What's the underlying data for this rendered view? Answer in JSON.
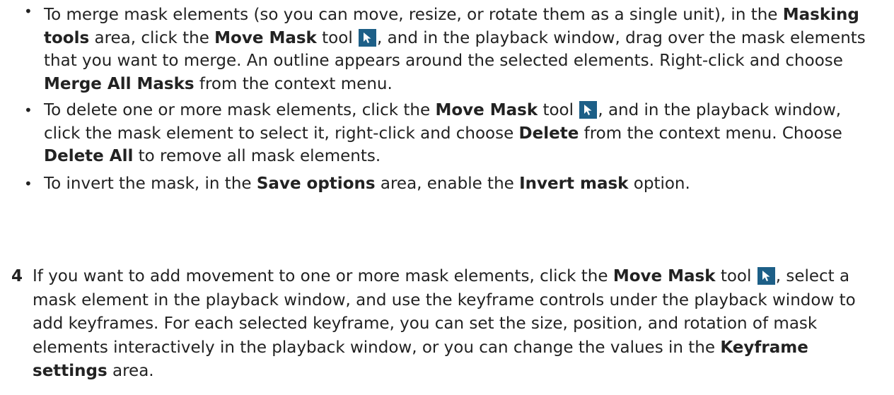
{
  "bullets": [
    {
      "dot": "•",
      "t1": "To merge mask elements (so you can move, resize, or rotate them as a single unit), in the ",
      "b1": "Masking tools",
      "t2": " area, click the ",
      "b2": "Move Mask",
      "t3": " tool ",
      "t4": ", and in the playback window, drag over the mask elements that you want to merge. An outline appears around the selected elements. Right-click and choose ",
      "b3": "Merge All Masks",
      "t5": " from the context menu."
    },
    {
      "dot": "•",
      "t1": "To delete one or more mask elements, click the ",
      "b1": "Move Mask",
      "t2": " tool ",
      "t3": ", and in the playback window, click the mask element to select it, right-click and choose ",
      "b2": "Delete",
      "t4": " from the context menu. Choose ",
      "b3": "Delete All",
      "t5": " to remove all mask elements."
    },
    {
      "dot": "•",
      "t1": "To invert the mask, in the ",
      "b1": "Save options",
      "t2": " area, enable the ",
      "b2": "Invert mask",
      "t3": " option."
    }
  ],
  "step": {
    "number": "4",
    "t1": "If you want to add movement to one or more mask elements, click the ",
    "b1": "Move Mask",
    "t2": " tool ",
    "t3": ", select a mask element in the playback window, and use the keyframe controls under the playback window to add keyframes. For each selected keyframe, you can set the size, position, and rotation of mask elements interactively in the playback window, or you can change the values in the ",
    "b2": "Keyframe settings",
    "t4": " area."
  },
  "icons": {
    "move_mask": "move-mask-cursor-icon",
    "icon_bg": "#1d5f87"
  }
}
